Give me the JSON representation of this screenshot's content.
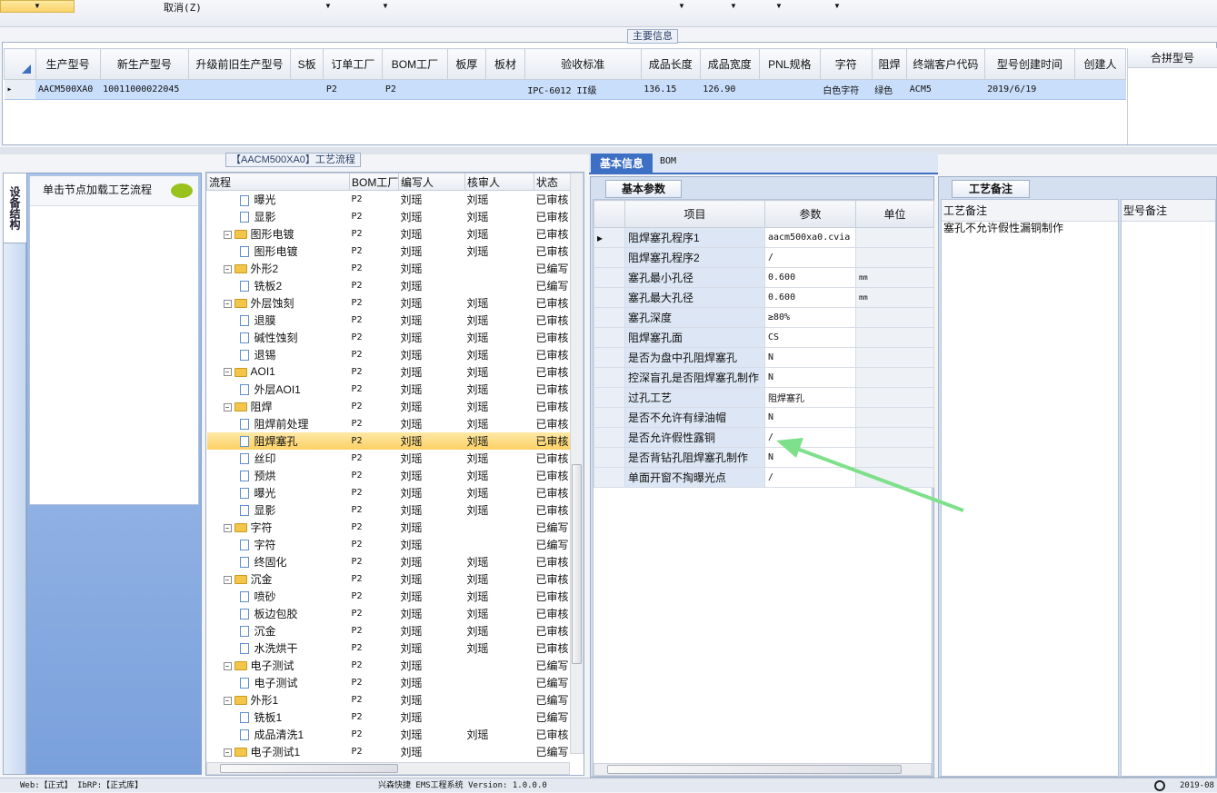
{
  "toolbar": {
    "cancel_label": "取消(Z)"
  },
  "main_info": {
    "title": "主要信息",
    "columns": [
      "生产型号",
      "新生产型号",
      "升级前旧生产型号",
      "S板",
      "订单工厂",
      "BOM工厂",
      "板厚",
      "板材",
      "验收标准",
      "成品长度",
      "成品宽度",
      "PNL规格",
      "字符",
      "阻焊",
      "终端客户代码",
      "型号创建时间",
      "创建人"
    ],
    "row": [
      "AACM500XA0",
      "10011000022045",
      "",
      "",
      "P2",
      "P2",
      "",
      "",
      "IPC-6012 II级",
      "136.15",
      "126.90",
      "",
      "白色字符",
      "绿色",
      "ACM5",
      "2019/6/19",
      ""
    ],
    "merge_header": "合拼型号"
  },
  "left_panel": {
    "vertical_tab": "设备结构",
    "hint": "单击节点加载工艺流程"
  },
  "flow": {
    "title": "【AACM500XA0】工艺流程",
    "columns": [
      "流程",
      "BOM工厂",
      "编写人",
      "核审人",
      "状态"
    ],
    "rows": [
      {
        "name": "曝光",
        "level": 1,
        "bom": "P2",
        "writer": "刘瑶",
        "reviewer": "刘瑶",
        "status": "已审核"
      },
      {
        "name": "显影",
        "level": 1,
        "bom": "P2",
        "writer": "刘瑶",
        "reviewer": "刘瑶",
        "status": "已审核"
      },
      {
        "name": "图形电镀",
        "level": 0,
        "bom": "P2",
        "writer": "刘瑶",
        "reviewer": "刘瑶",
        "status": "已审核"
      },
      {
        "name": "图形电镀",
        "level": 1,
        "bom": "P2",
        "writer": "刘瑶",
        "reviewer": "刘瑶",
        "status": "已审核"
      },
      {
        "name": "外形2",
        "level": 0,
        "bom": "P2",
        "writer": "刘瑶",
        "reviewer": "",
        "status": "已编写"
      },
      {
        "name": "铣板2",
        "level": 1,
        "bom": "P2",
        "writer": "刘瑶",
        "reviewer": "",
        "status": "已编写"
      },
      {
        "name": "外层蚀刻",
        "level": 0,
        "bom": "P2",
        "writer": "刘瑶",
        "reviewer": "刘瑶",
        "status": "已审核"
      },
      {
        "name": "退膜",
        "level": 1,
        "bom": "P2",
        "writer": "刘瑶",
        "reviewer": "刘瑶",
        "status": "已审核"
      },
      {
        "name": "碱性蚀刻",
        "level": 1,
        "bom": "P2",
        "writer": "刘瑶",
        "reviewer": "刘瑶",
        "status": "已审核"
      },
      {
        "name": "退锡",
        "level": 1,
        "bom": "P2",
        "writer": "刘瑶",
        "reviewer": "刘瑶",
        "status": "已审核"
      },
      {
        "name": "AOI1",
        "level": 0,
        "bom": "P2",
        "writer": "刘瑶",
        "reviewer": "刘瑶",
        "status": "已审核"
      },
      {
        "name": "外层AOI1",
        "level": 1,
        "bom": "P2",
        "writer": "刘瑶",
        "reviewer": "刘瑶",
        "status": "已审核"
      },
      {
        "name": "阻焊",
        "level": 0,
        "bom": "P2",
        "writer": "刘瑶",
        "reviewer": "刘瑶",
        "status": "已审核"
      },
      {
        "name": "阻焊前处理",
        "level": 1,
        "bom": "P2",
        "writer": "刘瑶",
        "reviewer": "刘瑶",
        "status": "已审核"
      },
      {
        "name": "阻焊塞孔",
        "level": 1,
        "bom": "P2",
        "writer": "刘瑶",
        "reviewer": "刘瑶",
        "status": "已审核",
        "selected": true
      },
      {
        "name": "丝印",
        "level": 1,
        "bom": "P2",
        "writer": "刘瑶",
        "reviewer": "刘瑶",
        "status": "已审核"
      },
      {
        "name": "预烘",
        "level": 1,
        "bom": "P2",
        "writer": "刘瑶",
        "reviewer": "刘瑶",
        "status": "已审核"
      },
      {
        "name": "曝光",
        "level": 1,
        "bom": "P2",
        "writer": "刘瑶",
        "reviewer": "刘瑶",
        "status": "已审核"
      },
      {
        "name": "显影",
        "level": 1,
        "bom": "P2",
        "writer": "刘瑶",
        "reviewer": "刘瑶",
        "status": "已审核"
      },
      {
        "name": "字符",
        "level": 0,
        "bom": "P2",
        "writer": "刘瑶",
        "reviewer": "",
        "status": "已编写"
      },
      {
        "name": "字符",
        "level": 1,
        "bom": "P2",
        "writer": "刘瑶",
        "reviewer": "",
        "status": "已编写"
      },
      {
        "name": "终固化",
        "level": 1,
        "bom": "P2",
        "writer": "刘瑶",
        "reviewer": "刘瑶",
        "status": "已审核"
      },
      {
        "name": "沉金",
        "level": 0,
        "bom": "P2",
        "writer": "刘瑶",
        "reviewer": "刘瑶",
        "status": "已审核"
      },
      {
        "name": "喷砂",
        "level": 1,
        "bom": "P2",
        "writer": "刘瑶",
        "reviewer": "刘瑶",
        "status": "已审核"
      },
      {
        "name": "板边包胶",
        "level": 1,
        "bom": "P2",
        "writer": "刘瑶",
        "reviewer": "刘瑶",
        "status": "已审核"
      },
      {
        "name": "沉金",
        "level": 1,
        "bom": "P2",
        "writer": "刘瑶",
        "reviewer": "刘瑶",
        "status": "已审核"
      },
      {
        "name": "水洗烘干",
        "level": 1,
        "bom": "P2",
        "writer": "刘瑶",
        "reviewer": "刘瑶",
        "status": "已审核"
      },
      {
        "name": "电子测试",
        "level": 0,
        "bom": "P2",
        "writer": "刘瑶",
        "reviewer": "",
        "status": "已编写"
      },
      {
        "name": "电子测试",
        "level": 1,
        "bom": "P2",
        "writer": "刘瑶",
        "reviewer": "",
        "status": "已编写"
      },
      {
        "name": "外形1",
        "level": 0,
        "bom": "P2",
        "writer": "刘瑶",
        "reviewer": "",
        "status": "已编写"
      },
      {
        "name": "铣板1",
        "level": 1,
        "bom": "P2",
        "writer": "刘瑶",
        "reviewer": "",
        "status": "已编写"
      },
      {
        "name": "成品清洗1",
        "level": 1,
        "bom": "P2",
        "writer": "刘瑶",
        "reviewer": "刘瑶",
        "status": "已审核"
      },
      {
        "name": "电子测试1",
        "level": 0,
        "bom": "P2",
        "writer": "刘瑶",
        "reviewer": "",
        "status": "已编写"
      }
    ]
  },
  "tabs": {
    "basic": "基本信息",
    "bom": "BOM"
  },
  "params": {
    "tab": "基本参数",
    "columns": [
      "项目",
      "参数",
      "单位"
    ],
    "rows": [
      {
        "item": "阻焊塞孔程序1",
        "value": "aacm500xa0.cvia",
        "unit": ""
      },
      {
        "item": "阻焊塞孔程序2",
        "value": "/",
        "unit": ""
      },
      {
        "item": "塞孔最小孔径",
        "value": "0.600",
        "unit": "mm"
      },
      {
        "item": "塞孔最大孔径",
        "value": "0.600",
        "unit": "mm"
      },
      {
        "item": "塞孔深度",
        "value": "≥80%",
        "unit": ""
      },
      {
        "item": "阻焊塞孔面",
        "value": "CS",
        "unit": ""
      },
      {
        "item": "是否为盘中孔阻焊塞孔",
        "value": "N",
        "unit": ""
      },
      {
        "item": "控深盲孔是否阻焊塞孔制作",
        "value": "N",
        "unit": ""
      },
      {
        "item": "过孔工艺",
        "value": "阻焊塞孔",
        "unit": ""
      },
      {
        "item": "是否不允许有绿油帽",
        "value": "N",
        "unit": ""
      },
      {
        "item": "是否允许假性露铜",
        "value": "/",
        "unit": ""
      },
      {
        "item": "是否背钻孔阻焊塞孔制作",
        "value": "N",
        "unit": ""
      },
      {
        "item": "单面开窗不掏曝光点",
        "value": "/",
        "unit": ""
      }
    ]
  },
  "remarks": {
    "tab": "工艺备注",
    "col1": "工艺备注",
    "col2": "型号备注",
    "text": "塞孔不允许假性漏铜制作"
  },
  "status_bar": {
    "left": "Web:【正式】 IbRP:【正式库】",
    "center": "兴森快捷 EMS工程系统 Version: 1.0.0.0",
    "right": "2019-08"
  },
  "colors": {
    "accent": "#3d6fc4",
    "selected_row": "#fbd064",
    "arrow": "#7ee08a"
  }
}
